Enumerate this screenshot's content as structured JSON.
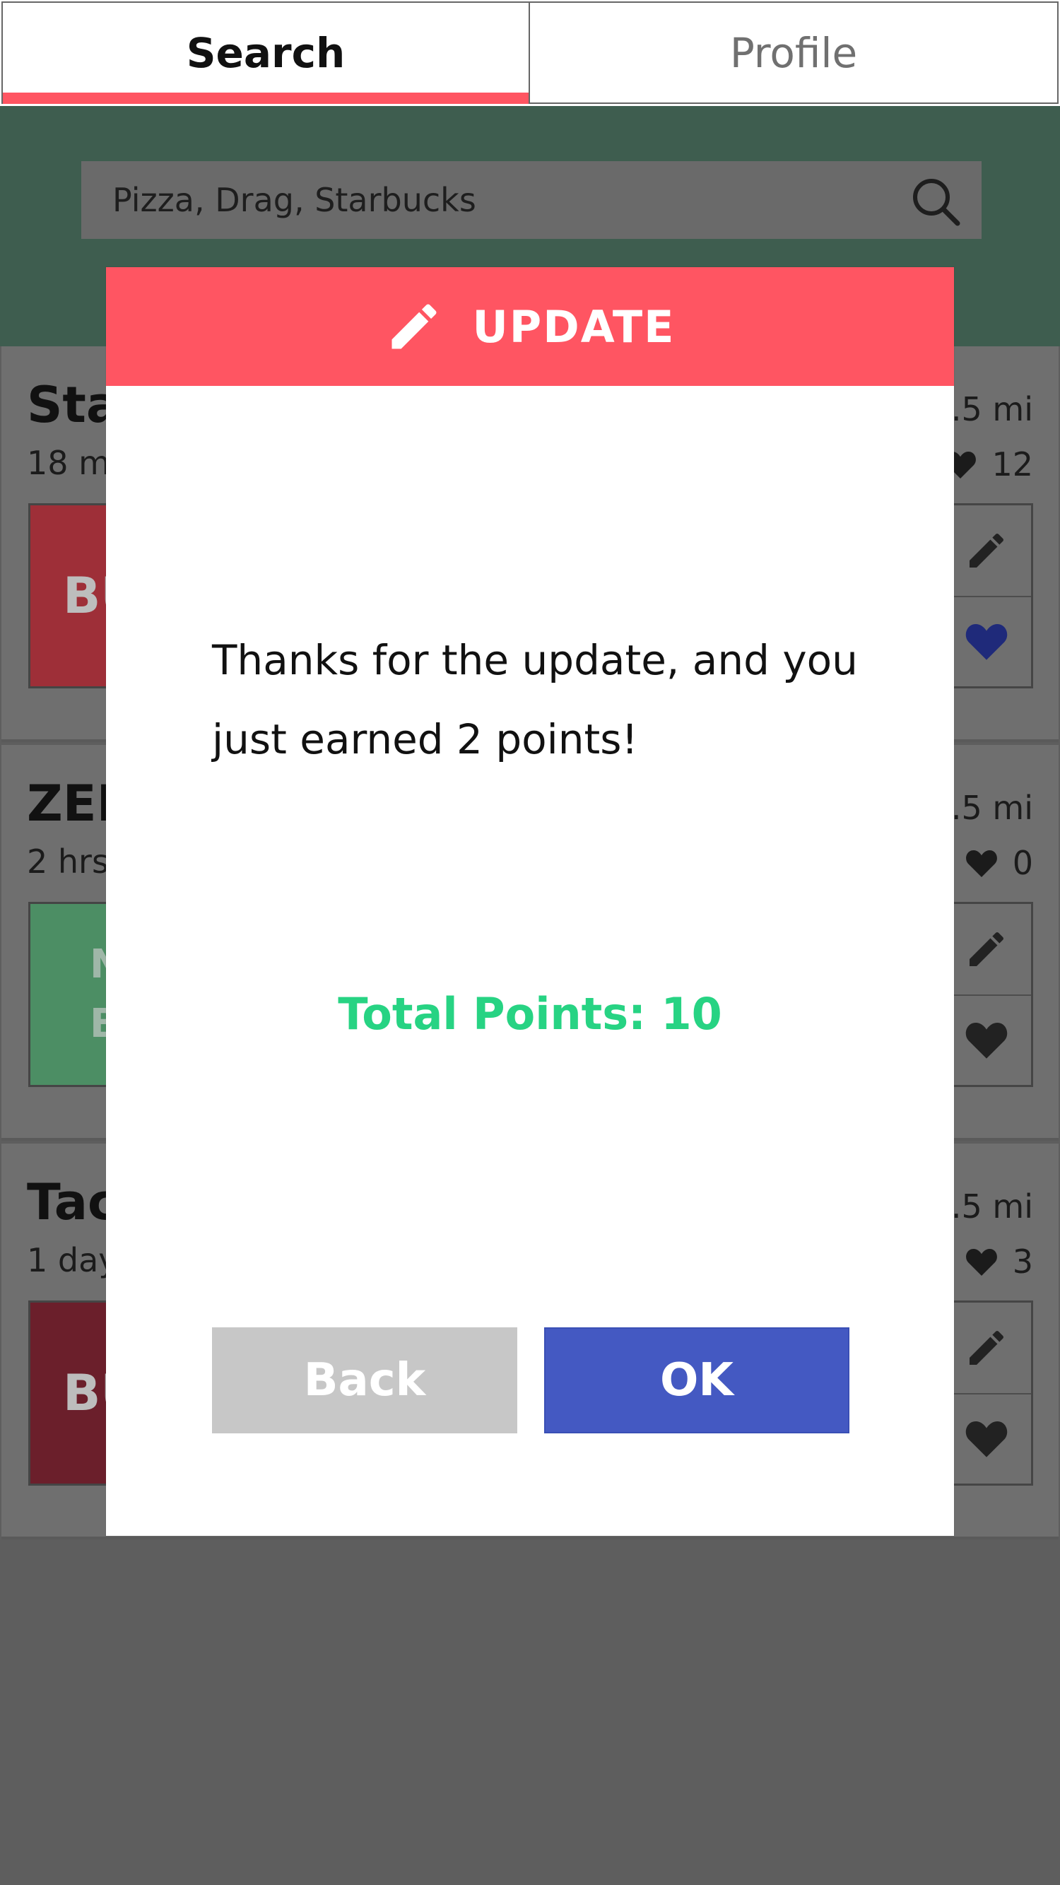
{
  "tabs": {
    "search_label": "Search",
    "profile_label": "Profile"
  },
  "search": {
    "placeholder": "Pizza, Drag, Starbucks"
  },
  "cards": [
    {
      "name": "Sta",
      "time": "18 m",
      "distance": ".5 mi",
      "likes": "12",
      "status": "BU"
    },
    {
      "name": "ZEN",
      "time": "2 hrs",
      "distance": ".5 mi",
      "likes": "0",
      "status_line1": "N",
      "status_line2": "B"
    },
    {
      "name": "Tac",
      "time": "1 day",
      "distance": ".5 mi",
      "likes": "3",
      "status": "BU"
    }
  ],
  "modal": {
    "title": "UPDATE",
    "message": "Thanks for the update, and you just earned 2 points!",
    "points_text": "Total Points: 10",
    "back_label": "Back",
    "ok_label": "OK"
  },
  "colors": {
    "accent": "#ff5562",
    "header_green": "#3e5d4f",
    "points_green": "#27d383",
    "ok_blue": "#4459c2",
    "back_gray": "#c7c7c7",
    "card1_status": "#9e2f38",
    "card2_status": "#4c8e64",
    "card3_status": "#6b1f2b",
    "liked_heart": "#1f2a7a"
  },
  "icons": {
    "search": "magnifier-icon",
    "edit": "pencil-icon",
    "like": "heart-icon"
  }
}
